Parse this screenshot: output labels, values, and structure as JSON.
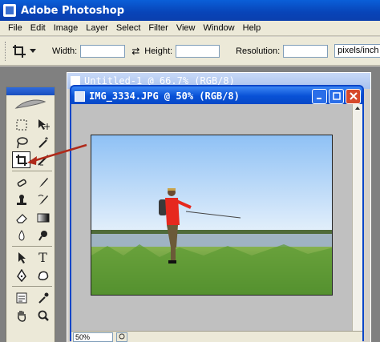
{
  "app": {
    "title": "Adobe Photoshop"
  },
  "menubar": {
    "items": [
      "File",
      "Edit",
      "Image",
      "Layer",
      "Select",
      "Filter",
      "View",
      "Window",
      "Help"
    ]
  },
  "options_bar": {
    "width_label": "Width:",
    "width_value": "",
    "height_label": "Height:",
    "height_value": "",
    "resolution_label": "Resolution:",
    "resolution_value": "",
    "resolution_unit": "pixels/inch"
  },
  "documents": {
    "background": {
      "title": "Untitled-1 @ 66.7% (RGB/8)"
    },
    "active": {
      "title": "IMG_3334.JPG @ 50% (RGB/8)",
      "zoom": "50%"
    }
  },
  "toolbox": {
    "tools": [
      {
        "name": "marquee-tool",
        "icon": "marquee-icon"
      },
      {
        "name": "move-tool",
        "icon": "move-icon"
      },
      {
        "name": "lasso-tool",
        "icon": "lasso-icon"
      },
      {
        "name": "magic-wand-tool",
        "icon": "magic-wand-icon"
      },
      {
        "name": "crop-tool",
        "icon": "crop-icon",
        "active": true
      },
      {
        "name": "slice-tool",
        "icon": "slice-icon"
      },
      {
        "name": "healing-brush-tool",
        "icon": "healing-brush-icon"
      },
      {
        "name": "brush-tool",
        "icon": "brush-icon"
      },
      {
        "name": "clone-stamp-tool",
        "icon": "stamp-icon"
      },
      {
        "name": "history-brush-tool",
        "icon": "history-brush-icon"
      },
      {
        "name": "eraser-tool",
        "icon": "eraser-icon"
      },
      {
        "name": "gradient-tool",
        "icon": "gradient-icon"
      },
      {
        "name": "blur-tool",
        "icon": "blur-icon"
      },
      {
        "name": "dodge-tool",
        "icon": "dodge-icon"
      },
      {
        "name": "path-selection-tool",
        "icon": "path-selection-icon"
      },
      {
        "name": "type-tool",
        "icon": "type-icon",
        "glyph": "T"
      },
      {
        "name": "pen-tool",
        "icon": "pen-icon"
      },
      {
        "name": "shape-tool",
        "icon": "shape-icon"
      },
      {
        "name": "notes-tool",
        "icon": "notes-icon"
      },
      {
        "name": "eyedropper-tool",
        "icon": "eyedropper-icon"
      },
      {
        "name": "hand-tool",
        "icon": "hand-icon"
      },
      {
        "name": "zoom-tool",
        "icon": "zoom-icon"
      }
    ]
  },
  "colors": {
    "title_bar": "#0a50d0",
    "callout_arrow": "#b02a1a",
    "foreground_swatch": "#1560e8",
    "close_button": "#d6492b"
  }
}
